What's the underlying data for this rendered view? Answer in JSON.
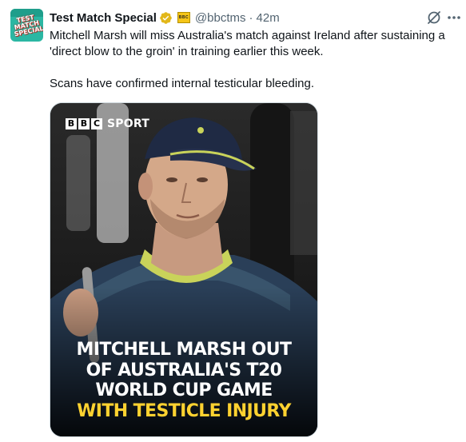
{
  "tweet": {
    "display_name": "Test Match Special",
    "handle": "@bbctms",
    "separator": "·",
    "time": "42m",
    "avatar_text": "TEST\nMATCH\nSPECIAL",
    "affiliate_badge_text": "BBC",
    "paragraphs": [
      "Mitchell Marsh will miss Australia's match against Ireland after sustaining a 'direct blow to the groin' in training earlier this week.",
      "Scans have confirmed internal testicular bleeding."
    ]
  },
  "media": {
    "brand_letters": [
      "B",
      "B",
      "C"
    ],
    "brand_sport": "SPORT",
    "headline_lines": [
      "MITCHELL MARSH OUT",
      "OF AUSTRALIA'S T20",
      "WORLD CUP GAME"
    ],
    "headline_highlight": "WITH TESTICLE INJURY"
  },
  "icons": {
    "verified": "verified-badge-icon",
    "grok": "grok-icon",
    "more": "more-options-icon"
  },
  "colors": {
    "verified_gold": "#e2b719",
    "text_secondary": "#536471",
    "headline_highlight": "#ffd230"
  }
}
